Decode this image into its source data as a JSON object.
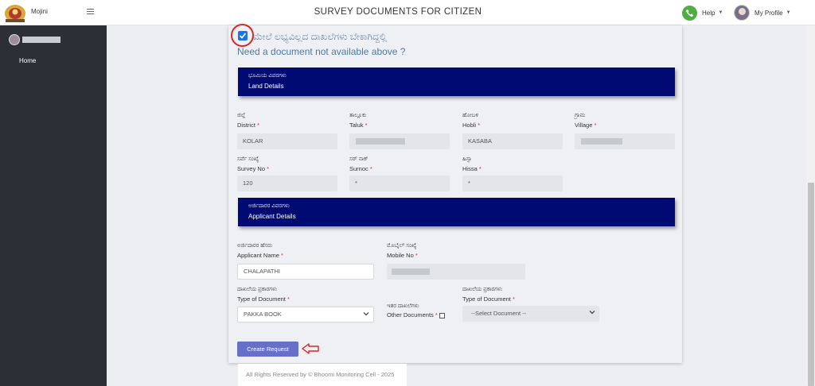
{
  "header": {
    "brand": "Mojini",
    "title": "SURVEY DOCUMENTS FOR CITIZEN",
    "help_label": "Help",
    "profile_label": "My Profile"
  },
  "sidebar": {
    "items": [
      {
        "label": "Home"
      }
    ]
  },
  "form": {
    "question_kn": "ಮೇಲೆ ಲಭ್ಯವಿಲ್ಲದ ದಾಖಲೆಗಳು ಬೇಕಾಗಿದ್ದಲ್ಲಿ",
    "question_en": "Need a document not available above ?",
    "land_section": {
      "title_kn": "ಭೂಮಿಯ ವಿವರಗಳು",
      "title_en": "Land Details"
    },
    "district": {
      "label_kn": "ಜಿಲ್ಲೆ",
      "label_en": "District",
      "value": "KOLAR"
    },
    "taluk": {
      "label_kn": "ತಾಲ್ಲೂಕು",
      "label_en": "Taluk"
    },
    "hobli": {
      "label_kn": "ಹೋಬಳಿ",
      "label_en": "Hobli",
      "value": "KASABA"
    },
    "village": {
      "label_kn": "ಗ್ರಾಮ",
      "label_en": "Village"
    },
    "survey_no": {
      "label_kn": "ಸರ್ವೆ ಸಂಖ್ಯೆ",
      "label_en": "Survey No",
      "value": "120"
    },
    "surnoc": {
      "label_kn": "ಸರ್ ನಾಕ್",
      "label_en": "Surnoc",
      "value": "*"
    },
    "hissa": {
      "label_kn": "ಹಿಸ್ಸಾ",
      "label_en": "Hissa",
      "value": "*"
    },
    "applicant_section": {
      "title_kn": "ಅರ್ಜಿದಾರರ ವಿವರಗಳು",
      "title_en": "Applicant Details"
    },
    "applicant_name": {
      "label_kn": "ಅರ್ಜಿದಾರರ ಹೆಸರು",
      "label_en": "Applicant Name",
      "value": "CHALAPATHI"
    },
    "mobile_no": {
      "label_kn": "ಮೊಬೈಲ್ ಸಂಖ್ಯೆ",
      "label_en": "Mobile No"
    },
    "type_of_document": {
      "label_kn": "ದಾಖಲೆಯ ಪ್ರಕಾರಗಳು",
      "label_en": "Type of Document",
      "value": "PAKKA BOOK"
    },
    "other_documents": {
      "label_kn": "ಇತರ ದಾಖಲೆಗಳು",
      "label_en": "Other Documents"
    },
    "type_of_document_2": {
      "label_kn": "ದಾಖಲೆಯ ಪ್ರಕಾರಗಳು",
      "label_en": "Type of Document",
      "value": "--Select Document --"
    },
    "required_mark": "*",
    "create_button": "Create Request"
  },
  "footer": {
    "text": "All Rights Reserved by © Bhoomi Monitoring Cell - 2025"
  },
  "colors": {
    "section_bar": "#000a73",
    "button": "#6670c9",
    "annotation": "#d52929",
    "sidebar": "#2c2f36"
  }
}
